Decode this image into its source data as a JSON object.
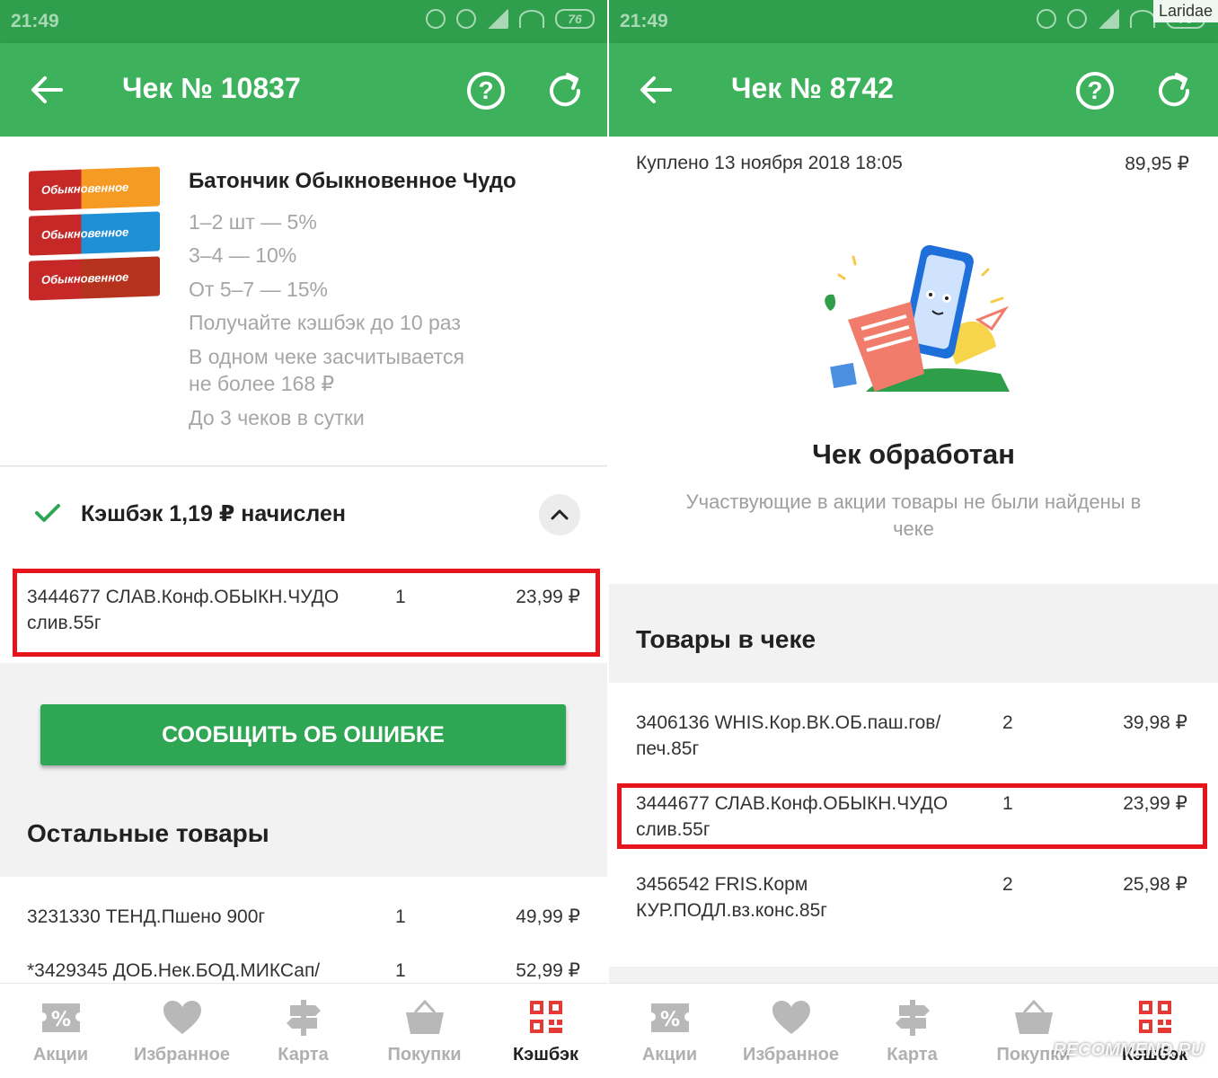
{
  "left": {
    "status": {
      "time": "21:49",
      "battery": "76"
    },
    "header": {
      "title": "Чек № 10837"
    },
    "product": {
      "title": "Батончик Обыкновенное Чудо",
      "image_labels": [
        "Обыкновенное ЧУДО",
        "Обыкновенное ЧУДО",
        "Обыкновенное ЧУДО"
      ],
      "conditions": [
        "1–2 шт — 5%",
        "3–4 — 10%",
        "От 5–7 — 15%",
        "Получайте кэшбэк до 10 раз",
        "В одном чеке засчитывается",
        "не более 168 ₽",
        "До 3 чеков в сутки"
      ]
    },
    "cashback": {
      "text": "Кэшбэк 1,19 ₽ начислен"
    },
    "highlight_item": {
      "name_line1": "3444677 СЛАВ.Конф.ОБЫКН.ЧУДО",
      "name_line2": "слив.55г",
      "qty": "1",
      "price": "23,99 ₽"
    },
    "report_button": "СООБЩИТЬ ОБ ОШИБКЕ",
    "other_title": "Остальные товары",
    "other_items": [
      {
        "name": "3231330 ТЕНД.Пшено 900г",
        "qty": "1",
        "price": "49,99 ₽"
      },
      {
        "name": "*3429345 ДОБ.Нек.БОД.МИКСап/",
        "qty": "1",
        "price": "52,99 ₽"
      }
    ]
  },
  "right": {
    "status": {
      "time": "21:49",
      "battery": "76"
    },
    "header": {
      "title": "Чек № 8742"
    },
    "bought": {
      "text": "Куплено 13 ноября 2018 18:05",
      "price": "89,95 ₽"
    },
    "processed": {
      "title": "Чек обработан",
      "subtitle_line1": "Участвующие в акции товары не были найдены в",
      "subtitle_line2": "чеке"
    },
    "items_title": "Товары в чеке",
    "items": [
      {
        "name_line1": "3406136 WHIS.Кор.ВК.ОБ.паш.гов/",
        "name_line2": "печ.85г",
        "qty": "2",
        "price": "39,98 ₽"
      },
      {
        "name_line1": "3444677 СЛАВ.Конф.ОБЫКН.ЧУДО",
        "name_line2": "слив.55г",
        "qty": "1",
        "price": "23,99 ₽"
      },
      {
        "name_line1": "3456542 FRIS.Корм",
        "name_line2": "КУР.ПОДЛ.вз.конс.85г",
        "qty": "2",
        "price": "25,98 ₽"
      }
    ]
  },
  "nav": {
    "items": [
      {
        "label": "Акции",
        "icon": "percent-coupon-icon"
      },
      {
        "label": "Избранное",
        "icon": "heart-icon"
      },
      {
        "label": "Карта",
        "icon": "signpost-icon"
      },
      {
        "label": "Покупки",
        "icon": "basket-icon"
      },
      {
        "label": "Кэшбэк",
        "icon": "qr-code-icon"
      }
    ],
    "active_index": 4
  },
  "watermark": "Laridae",
  "recommend_mark": "RECOMMEND.RU",
  "colors": {
    "status_bar": "#2f9f4d",
    "app_bar": "#3db15b",
    "button": "#2fa654",
    "highlight": "#e8141c",
    "cashback_nav": "#e53935"
  }
}
